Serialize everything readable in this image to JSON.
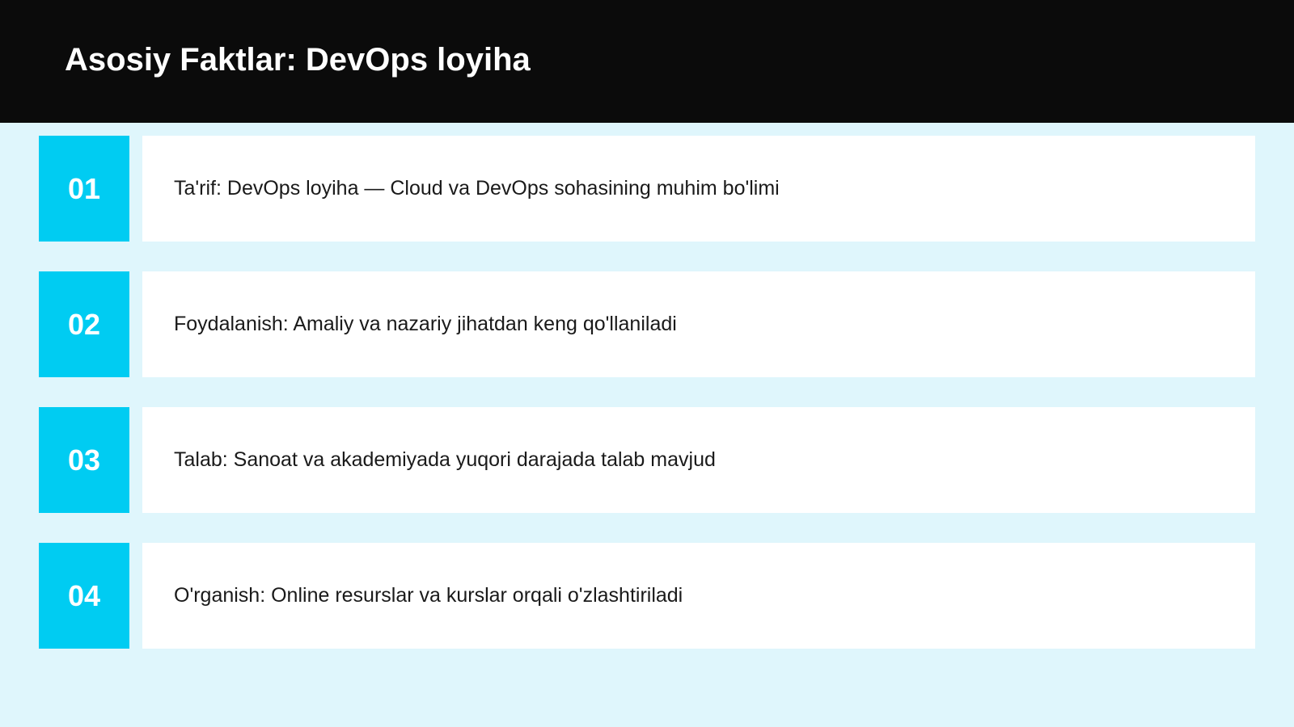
{
  "slide": {
    "title": "Asosiy Faktlar: DevOps loyiha"
  },
  "colors": {
    "header_bg": "#0b0b0b",
    "accent": "#00ccf2",
    "background": "#dff6fc",
    "card": "#ffffff"
  },
  "facts": [
    {
      "number": "01",
      "text": "Ta'rif: DevOps loyiha — Cloud va DevOps sohasining muhim bo'limi"
    },
    {
      "number": "02",
      "text": "Foydalanish: Amaliy va nazariy jihatdan keng qo'llaniladi"
    },
    {
      "number": "03",
      "text": "Talab: Sanoat va akademiyada yuqori darajada talab mavjud"
    },
    {
      "number": "04",
      "text": "O'rganish: Online resurslar va kurslar orqali o'zlashtiriladi"
    }
  ]
}
